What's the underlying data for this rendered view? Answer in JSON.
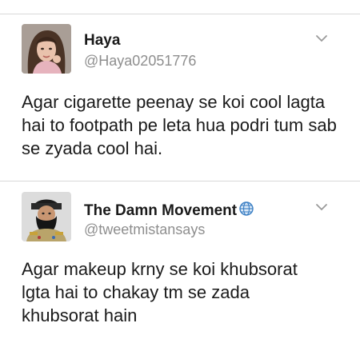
{
  "tweets": [
    {
      "name": "Haya",
      "handle": "@Haya02051776",
      "text": "Agar cigarette peenay se koi cool lagta hai to footpath pe leta hua podri tum sab se zyada cool hai.",
      "avatar": "woman-portrait"
    },
    {
      "name": "The Damn Movement",
      "handle": "@tweetmistansays",
      "text": "Agar makeup krny se koi khubsorat lgta hai to chakay tm se zada khubsorat hain",
      "avatar": "bearded-general-portrait",
      "badge_icon": "globe-icon"
    }
  ],
  "colors": {
    "text": "#1a1a1a",
    "handle": "#8e8e8e",
    "divider": "#d9d9d9",
    "globe": "#3b7fc4"
  }
}
